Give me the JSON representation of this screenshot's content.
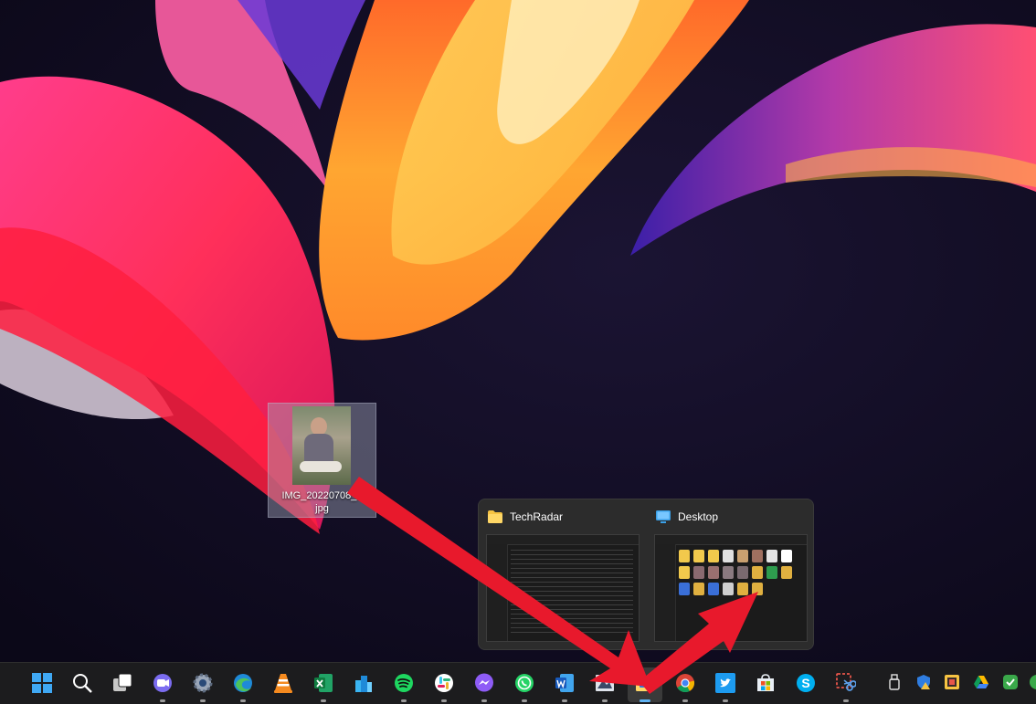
{
  "desktop": {
    "wallpaper": "windows-11-bloom-wallpaper",
    "file_icon": {
      "name": "IMG_20220708_1__JPG",
      "label_line1": "IMG_20220708_1",
      "label_line2": "jpg"
    }
  },
  "preview": {
    "windows": [
      {
        "title": "TechRadar",
        "icon": "folder-icon"
      },
      {
        "title": "Desktop",
        "icon": "desktop-icon"
      }
    ]
  },
  "taskbar": {
    "items": [
      {
        "name": "start",
        "icon": "windows-logo-icon"
      },
      {
        "name": "search",
        "icon": "search-icon"
      },
      {
        "name": "task-view",
        "icon": "task-view-icon"
      },
      {
        "name": "teams-chat",
        "icon": "video-chat-icon"
      },
      {
        "name": "settings",
        "icon": "gear-icon"
      },
      {
        "name": "edge",
        "icon": "edge-icon"
      },
      {
        "name": "vlc",
        "icon": "vlc-cone-icon"
      },
      {
        "name": "excel",
        "icon": "excel-icon"
      },
      {
        "name": "app-blue",
        "icon": "blue-buildings-icon"
      },
      {
        "name": "spotify",
        "icon": "spotify-icon"
      },
      {
        "name": "slack",
        "icon": "slack-icon"
      },
      {
        "name": "messenger",
        "icon": "messenger-icon"
      },
      {
        "name": "whatsapp",
        "icon": "whatsapp-icon"
      },
      {
        "name": "word",
        "icon": "word-icon"
      },
      {
        "name": "photo-app",
        "icon": "photo-editor-icon"
      },
      {
        "name": "file-explorer",
        "icon": "file-explorer-icon"
      },
      {
        "name": "chrome",
        "icon": "chrome-icon"
      },
      {
        "name": "twitter",
        "icon": "twitter-icon"
      },
      {
        "name": "ms-store",
        "icon": "store-icon"
      },
      {
        "name": "skype",
        "icon": "skype-icon"
      },
      {
        "name": "snipping-tool",
        "icon": "snipping-tool-icon"
      }
    ],
    "tray": [
      "usb-icon",
      "security-warning-icon",
      "tray-app-icon",
      "google-drive-icon",
      "check-shield-icon",
      "network-icon"
    ]
  },
  "colors": {
    "arrow": "#e8192c",
    "taskbar_bg": "#1c1c1e",
    "preview_bg": "#2c2c2c",
    "accent": "#5fb2f2"
  }
}
